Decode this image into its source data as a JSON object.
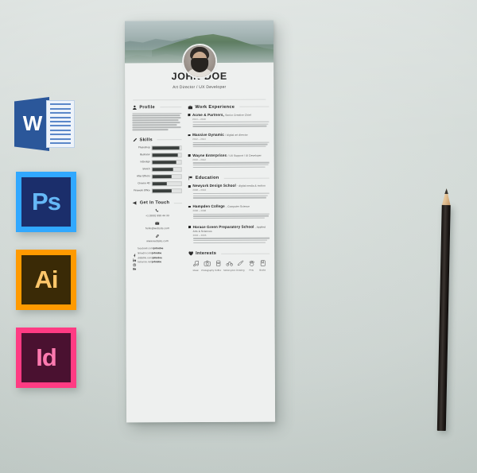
{
  "resume": {
    "name": "JOHN DOE",
    "role": "Art Director / UX Developer",
    "sections": {
      "profile": {
        "title": "Profile",
        "icon": "person-icon"
      },
      "skills": {
        "title": "Skills",
        "icon": "pencil-icon"
      },
      "contact": {
        "title": "Get In Touch",
        "icon": "megaphone-icon"
      },
      "work": {
        "title": "Work Experience",
        "icon": "briefcase-icon"
      },
      "education": {
        "title": "Education",
        "icon": "flag-icon"
      },
      "interests": {
        "title": "Interests",
        "icon": "heart-icon"
      }
    },
    "skills": [
      {
        "label": "Photoshop",
        "value": 95
      },
      {
        "label": "Illustrator",
        "value": 88
      },
      {
        "label": "InDesign",
        "value": 82
      },
      {
        "label": "Sketch",
        "value": 72
      },
      {
        "label": "After Effects",
        "value": 68
      },
      {
        "label": "Cinema 4D",
        "value": 50
      },
      {
        "label": "Firework Office",
        "value": 66
      }
    ],
    "contact": {
      "phone": "+1 (800) 999 44 33",
      "email": "hello@website.com",
      "website": "www.website.com",
      "socials": [
        {
          "icon": "facebook-icon",
          "prefix": "facebook.com/",
          "handle": "johndoe"
        },
        {
          "icon": "linkedin-icon",
          "prefix": "linkedin.com/",
          "handle": "johndoe"
        },
        {
          "icon": "dribbble-icon",
          "prefix": "dribbble.com/",
          "handle": "johndoe"
        },
        {
          "icon": "behance-icon",
          "prefix": "behance.net/",
          "handle": "johndoe"
        }
      ]
    },
    "work": [
      {
        "company": "Acme & Partners,",
        "position": "Senior Creative Chief",
        "date": "2014 – 2018"
      },
      {
        "company": "Massive Dynamic",
        "position": "/ digital art director",
        "date": "2012 – 2014"
      },
      {
        "company": "Wayne Enterprises",
        "position": "/ UX Support / UI Developer",
        "date": "2010 – 2012"
      }
    ],
    "education": [
      {
        "school": "Newyork Design School",
        "degree": "- digital media & motion",
        "date": "2008 – 2010"
      },
      {
        "school": "Hampden College",
        "degree": ", Computer Science",
        "date": "2006 – 2008"
      },
      {
        "school": "Horace Green Preparatory School",
        "degree": ", Applied Arts & Sciences",
        "date": "2002 – 2006"
      }
    ],
    "interests": [
      {
        "label": "Music",
        "icon": "music-note-icon"
      },
      {
        "label": "Photography",
        "icon": "camera-icon"
      },
      {
        "label": "Coffee",
        "icon": "coffee-cup-icon"
      },
      {
        "label": "Motorcycles",
        "icon": "bicycle-icon"
      },
      {
        "label": "Drawing",
        "icon": "pen-nib-icon"
      },
      {
        "label": "Pets",
        "icon": "paw-icon"
      },
      {
        "label": "Books",
        "icon": "book-icon"
      }
    ]
  },
  "apps": [
    {
      "name": "word-app-icon",
      "glyph": "W",
      "accent": "#2B579A"
    },
    {
      "name": "photoshop-app-icon",
      "glyph": "Ps",
      "accent": "#31A8FF"
    },
    {
      "name": "illustrator-app-icon",
      "glyph": "Ai",
      "accent": "#FF9A00"
    },
    {
      "name": "indesign-app-icon",
      "glyph": "Id",
      "accent": "#FF3B83"
    }
  ],
  "scene": {
    "background_color": "#d2dad7",
    "paper_color": "#eef0ef",
    "pencil": "black-pencil"
  }
}
